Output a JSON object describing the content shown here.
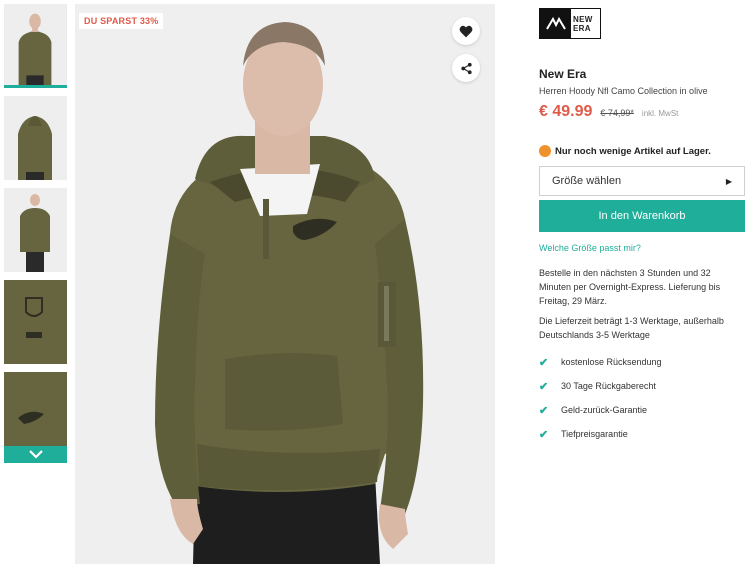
{
  "thumbnails": [
    {
      "name": "thumbnail-front-view",
      "active": true
    },
    {
      "name": "thumbnail-back-view",
      "active": false
    },
    {
      "name": "thumbnail-front-full",
      "active": false
    },
    {
      "name": "thumbnail-nfl-patch",
      "active": false
    },
    {
      "name": "thumbnail-logo-detail",
      "active": false
    }
  ],
  "icons": {
    "thumb_scroll": "chevron-down-icon",
    "favorite": "heart-icon",
    "share": "share-icon",
    "stock": "orange-dot-icon",
    "size_caret": "caret-right-icon",
    "benefit": "check-icon"
  },
  "image": {
    "badge": "DU SPARST 33%"
  },
  "brand": {
    "logo_top": "NEW",
    "logo_bottom": "ERA",
    "name": "New Era"
  },
  "product": {
    "title": "Herren Hoody Nfl Camo Collection in olive"
  },
  "price": {
    "current": "€ 49.99",
    "old": "€ 74,99*",
    "tax_note": "inkl. MwSt"
  },
  "stock": {
    "text": "Nur noch wenige Artikel auf Lager."
  },
  "size_select": {
    "label": "Größe wählen",
    "caret": "▶"
  },
  "cart_button": {
    "label": "In den Warenkorb"
  },
  "size_help_link": "Welche Größe passt mir?",
  "delivery": {
    "express": "Bestelle in den nächsten 3 Stunden und 32 Minuten per Overnight-Express. Lieferung bis Freitag, 29 März.",
    "lead_time": "Die Lieferzeit beträgt 1-3 Werktage, außerhalb Deutschlands 3-5 Werktage"
  },
  "benefits": [
    "kostenlose Rücksendung",
    "30 Tage Rückgaberecht",
    "Geld-zurück-Garantie",
    "Tiefpreisgarantie"
  ],
  "colors": {
    "accent": "#1fae99",
    "sale_red": "#e05a4a",
    "stock_orange": "#f0922b",
    "hoodie_olive": "#66653f"
  }
}
